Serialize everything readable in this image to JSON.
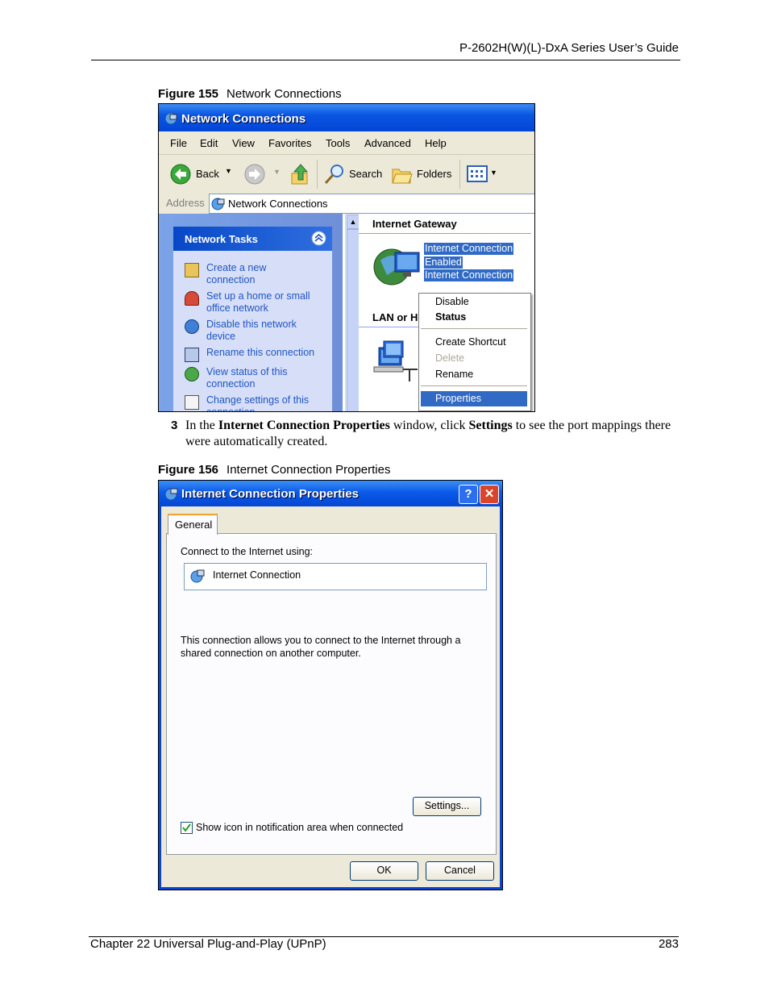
{
  "page": {
    "header_title": "P-2602H(W)(L)-DxA Series User’s Guide",
    "footer_left": "Chapter 22 Universal Plug-and-Play (UPnP)",
    "footer_right": "283"
  },
  "figure155": {
    "label": "Figure 155",
    "caption": "Network Connections",
    "window": {
      "title": "Network Connections",
      "menu": [
        "File",
        "Edit",
        "View",
        "Favorites",
        "Tools",
        "Advanced",
        "Help"
      ],
      "toolbar": {
        "back": "Back",
        "search": "Search",
        "folders": "Folders"
      },
      "address_label": "Address",
      "address_value": "Network Connections",
      "tasks_header": "Network Tasks",
      "tasks": [
        {
          "l1": "Create a new",
          "l2": "connection",
          "icon": "new-connection-icon"
        },
        {
          "l1": "Set up a home or small",
          "l2": "office network",
          "icon": "home-network-icon"
        },
        {
          "l1": "Disable this network",
          "l2": "device",
          "icon": "disable-network-icon"
        },
        {
          "l1": "Rename this connection",
          "l2": "",
          "icon": "rename-icon"
        },
        {
          "l1": "View status of this",
          "l2": "connection",
          "icon": "status-icon"
        },
        {
          "l1": "Change settings of this",
          "l2": "connection",
          "icon": "settings-icon"
        }
      ],
      "section_gateway": "Internet Gateway",
      "gateway_item": [
        "Internet Connection",
        "Enabled",
        "Internet Connection"
      ],
      "section_lan": "LAN or H",
      "context_menu": {
        "disable": "Disable",
        "status": "Status",
        "create_shortcut": "Create Shortcut",
        "delete": "Delete",
        "rename": "Rename",
        "properties": "Properties"
      }
    }
  },
  "step": {
    "number": "3",
    "pre": "In the ",
    "b1": "Internet Connection Properties",
    "mid": " window, click ",
    "b2": "Settings",
    "post": " to see the port mappings there were automatically created."
  },
  "figure156": {
    "label": "Figure 156",
    "caption": "Internet Connection Properties",
    "dialog": {
      "title": "Internet Connection Properties",
      "tab": "General",
      "connect_label": "Connect to the Internet using:",
      "connection_name": "Internet Connection",
      "description_l1": "This connection allows you to connect to the Internet through a",
      "description_l2": "shared connection on another computer.",
      "settings_button": "Settings...",
      "show_icon_label": "Show icon in notification area when connected",
      "show_icon_checked": true,
      "ok_button": "OK",
      "cancel_button": "Cancel"
    }
  },
  "colors": {
    "xp_title_blue": "#0a55e2",
    "xp_face": "#ece9d8",
    "selection": "#316ac5",
    "link_blue": "#2155c3"
  }
}
